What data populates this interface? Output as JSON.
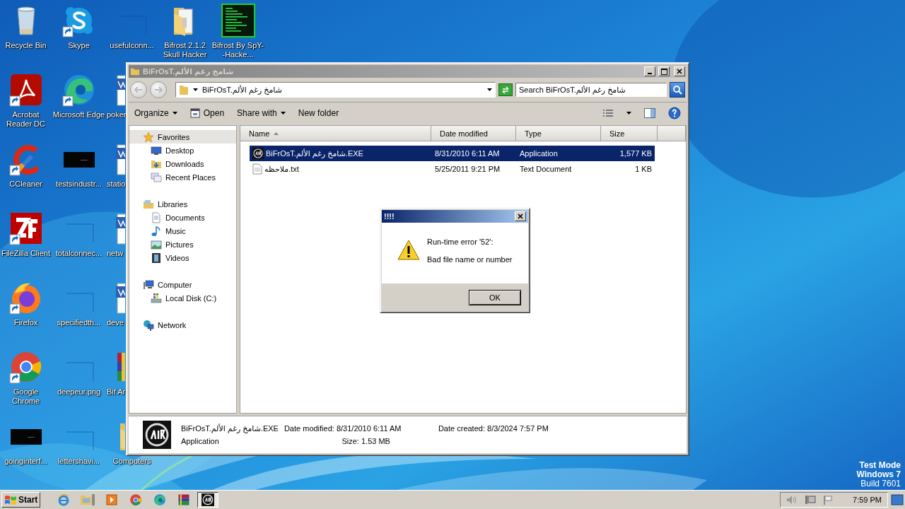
{
  "desktop": {
    "icon_columns": [
      {
        "icons": [
          {
            "label": "Recycle Bin",
            "kind": "recycle",
            "shortcut": false,
            "covered": false
          },
          {
            "label": "Acrobat Reader DC",
            "kind": "acrobat",
            "shortcut": true,
            "covered": false
          },
          {
            "label": "CCleaner",
            "kind": "ccleaner",
            "shortcut": true,
            "covered": false
          },
          {
            "label": "FileZilla Client",
            "kind": "filezilla",
            "shortcut": true,
            "covered": false
          },
          {
            "label": "Firefox",
            "kind": "firefox",
            "shortcut": true,
            "covered": false
          },
          {
            "label": "Google Chrome",
            "kind": "chrome",
            "shortcut": true,
            "covered": false
          },
          {
            "label": "goinginterf...",
            "kind": "dark-thumb",
            "shortcut": false,
            "covered": false
          }
        ]
      },
      {
        "icons": [
          {
            "label": "Skype",
            "kind": "skype",
            "shortcut": true,
            "covered": false
          },
          {
            "label": "Microsoft Edge",
            "kind": "edge",
            "shortcut": true,
            "covered": false
          },
          {
            "label": "testsindustr...",
            "kind": "dark-thumb",
            "shortcut": false,
            "covered": false
          },
          {
            "label": "totalconnec...",
            "kind": "blank-thumb",
            "shortcut": false,
            "covered": false
          },
          {
            "label": "specifiedth...",
            "kind": "blank-thumb",
            "shortcut": false,
            "covered": false
          },
          {
            "label": "deepeur.png",
            "kind": "blank-thumb",
            "shortcut": false,
            "covered": false
          },
          {
            "label": "lettershavi...",
            "kind": "blank-thumb",
            "shortcut": false,
            "covered": false
          }
        ]
      },
      {
        "icons": [
          {
            "label": "usefulconn...",
            "kind": "blank-thumb",
            "shortcut": false,
            "covered": false
          },
          {
            "label": "poker",
            "kind": "word",
            "shortcut": false,
            "covered": true
          },
          {
            "label": "statio",
            "kind": "word",
            "shortcut": false,
            "covered": true
          },
          {
            "label": "netw",
            "kind": "word",
            "shortcut": false,
            "covered": true
          },
          {
            "label": "deve",
            "kind": "word",
            "shortcut": false,
            "covered": true
          },
          {
            "label": "Bif Ar",
            "kind": "winrar",
            "shortcut": false,
            "covered": true
          },
          {
            "label": "Computers",
            "kind": "folder",
            "shortcut": false,
            "covered": false,
            "icon_covered": true
          }
        ]
      },
      {
        "icons": [
          {
            "label": "Bifrost 2.1.2 Skull Hacker",
            "kind": "folder",
            "shortcut": false,
            "covered": false
          }
        ]
      },
      {
        "icons": [
          {
            "label": "Bifrost By SpY--Hacke...",
            "kind": "terminal",
            "shortcut": false,
            "covered": false
          }
        ]
      }
    ],
    "watermark": [
      {
        "text": "Test Mode",
        "bold": true
      },
      {
        "text": "Windows 7",
        "bold": true
      },
      {
        "text": "Build 7601",
        "bold": false
      }
    ]
  },
  "explorer": {
    "title": "BiFrOsT.شامخ رغم الألم",
    "address": "BiFrOsT.شامخ رغم الألم",
    "search": {
      "placeholder": "Search BiFrOsT.شامخ رغم الألم"
    },
    "toolbar": [
      {
        "label": "Organize",
        "dropdown": true,
        "kind": "plain"
      },
      {
        "label": "Open",
        "dropdown": false,
        "kind": "open"
      },
      {
        "label": "Share with",
        "dropdown": true,
        "kind": "plain"
      },
      {
        "label": "New folder",
        "dropdown": false,
        "kind": "plain"
      }
    ],
    "navigation": [
      {
        "label": "Favorites",
        "kind": "star",
        "selected": true,
        "children": [
          {
            "label": "Desktop",
            "kind": "desktop",
            "selected": false
          },
          {
            "label": "Downloads",
            "kind": "downloads",
            "selected": false
          },
          {
            "label": "Recent Places",
            "kind": "recent",
            "selected": false
          }
        ]
      },
      {
        "label": "Libraries",
        "kind": "library",
        "selected": false,
        "children": [
          {
            "label": "Documents",
            "kind": "document",
            "selected": false
          },
          {
            "label": "Music",
            "kind": "music",
            "selected": false
          },
          {
            "label": "Pictures",
            "kind": "pictures",
            "selected": false
          },
          {
            "label": "Videos",
            "kind": "videos",
            "selected": false
          }
        ]
      },
      {
        "label": "Computer",
        "kind": "computer",
        "selected": false,
        "children": [
          {
            "label": "Local Disk (C:)",
            "kind": "disk",
            "selected": false
          }
        ]
      },
      {
        "label": "Network",
        "kind": "network",
        "selected": false
      }
    ],
    "columns": [
      {
        "label": "Name",
        "sorted": true
      },
      {
        "label": "Date modified",
        "sorted": false
      },
      {
        "label": "Type",
        "sorted": false
      },
      {
        "label": "Size",
        "sorted": false
      }
    ],
    "files": [
      {
        "name": "BiFrOsT.شامخ رغم الألم.EXE",
        "date_modified": "8/31/2010 6:11 AM",
        "type": "Application",
        "size": "1,577 KB",
        "kind": "app",
        "selected": true
      },
      {
        "name": "ملاحظه.txt",
        "date_modified": "5/25/2011 9:21 PM",
        "type": "Text Document",
        "size": "1 KB",
        "kind": "text",
        "selected": false
      }
    ],
    "details": {
      "name": "BiFrOsT.شامخ رغم الألم.EXE",
      "type": "Application",
      "fields": [
        {
          "label": "Date modified:",
          "value": "8/31/2010 6:11 AM"
        },
        {
          "label": "Date created:",
          "value": "8/3/2024 7:57 PM"
        },
        {
          "label": "Size:",
          "value": "1.53 MB"
        }
      ]
    }
  },
  "dialog": {
    "title": "!!!!",
    "message": "Run-time error '52':",
    "detail": "Bad file name or number",
    "button": "OK"
  },
  "taskbar": {
    "start": "Start",
    "items": [
      {
        "kind": "ie",
        "selected": false
      },
      {
        "kind": "explorer",
        "selected": false
      },
      {
        "kind": "media",
        "selected": false
      },
      {
        "kind": "chrome",
        "selected": false
      },
      {
        "kind": "edge",
        "selected": false
      },
      {
        "kind": "winrar",
        "selected": false
      },
      {
        "kind": "app",
        "selected": true
      }
    ],
    "tray": [
      {
        "kind": "speaker"
      },
      {
        "kind": "network"
      },
      {
        "kind": "flag"
      }
    ],
    "clock": "7:59 PM"
  }
}
